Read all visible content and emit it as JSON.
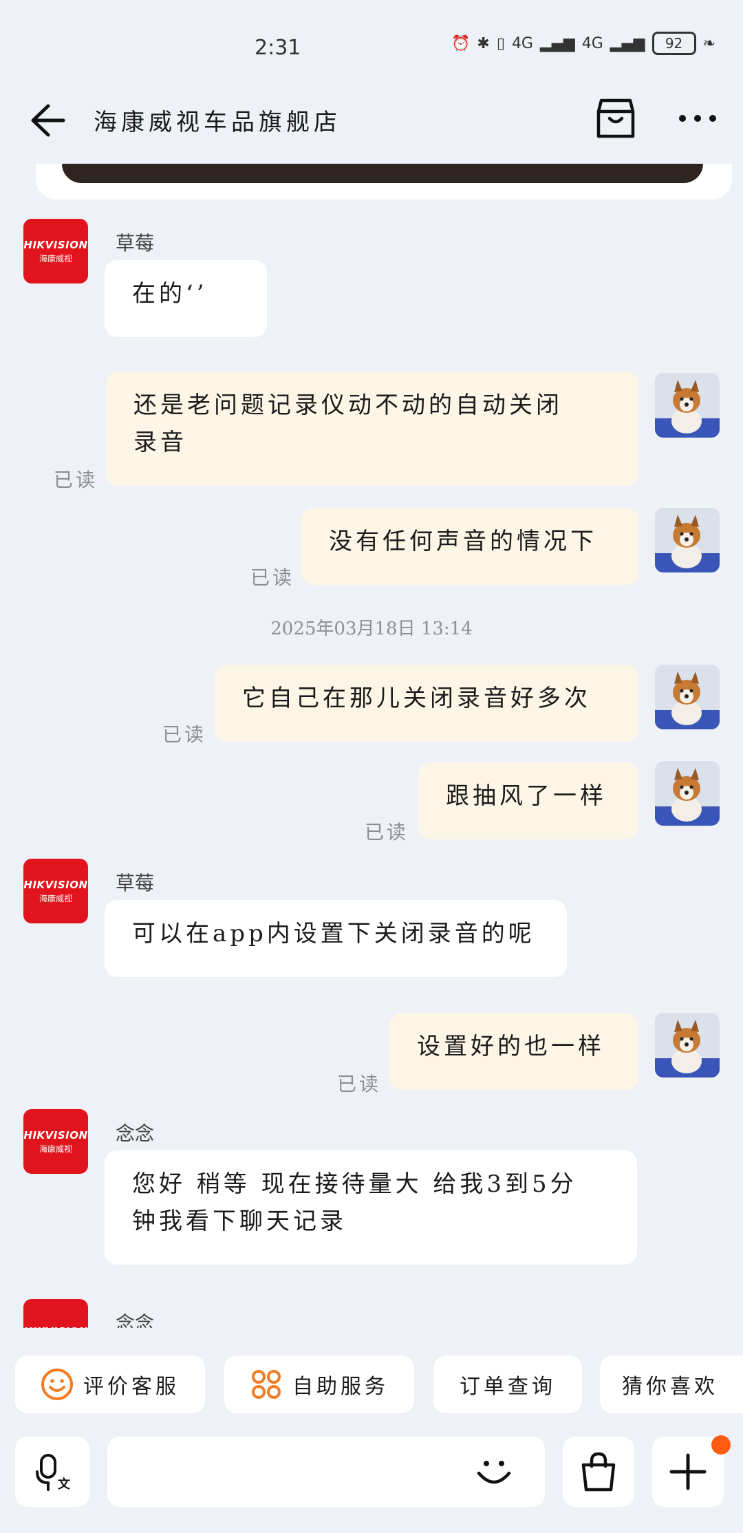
{
  "status": {
    "time": "2:31",
    "network1": "4G",
    "network2": "4G",
    "battery": "92"
  },
  "header": {
    "title": "海康威视车品旗舰店"
  },
  "brand": {
    "line1": "HIKVISION",
    "line2": "海康威视"
  },
  "messages": [
    {
      "sender": "草莓",
      "text": "在的‘’"
    },
    {
      "text_line1": "还是老问题记录仪动不动的自动关闭",
      "text_line2": "录音",
      "read": "已读"
    },
    {
      "text": "没有任何声音的情况下",
      "read": "已读"
    },
    {
      "timestamp": "2025年03月18日 13:14"
    },
    {
      "text": "它自己在那儿关闭录音好多次",
      "read": "已读"
    },
    {
      "text": "跟抽风了一样",
      "read": "已读"
    },
    {
      "sender": "草莓",
      "text": "可以在app内设置下关闭录音的呢"
    },
    {
      "text": "设置好的也一样",
      "read": "已读"
    },
    {
      "sender": "念念",
      "text_line1": "您好 稍等 现在接待量大 给我3到5分",
      "text_line2": "钟我看下聊天记录"
    },
    {
      "sender": "念念"
    }
  ],
  "quick_actions": [
    {
      "label": "评价客服",
      "icon": "smile-icon"
    },
    {
      "label": "自助服务",
      "icon": "grid-icon"
    },
    {
      "label": "订单查询",
      "icon": ""
    },
    {
      "label": "猜你喜欢",
      "icon": ""
    }
  ],
  "colors": {
    "brand_red": "#e1141e",
    "accent_orange": "#f47c20",
    "notify_dot": "#ff5a12",
    "outgoing_bubble": "#fdf6e7"
  }
}
